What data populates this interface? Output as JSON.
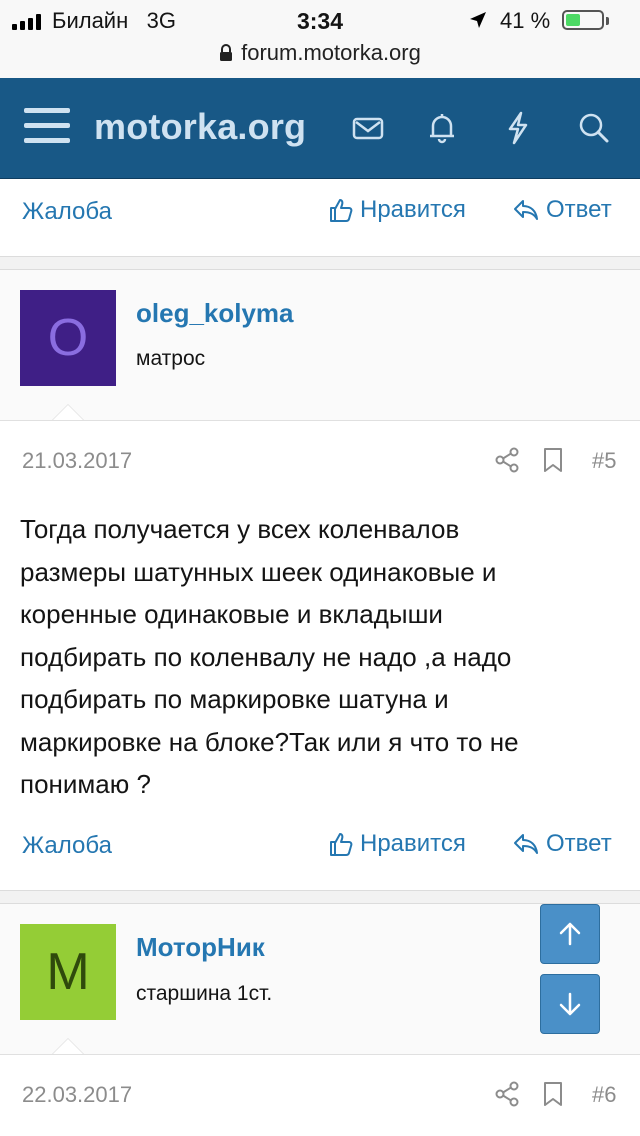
{
  "status_bar": {
    "carrier": "Билайн",
    "network": "3G",
    "time": "3:34",
    "battery_percent": "41 %",
    "battery_level": 0.41,
    "url": "forum.motorka.org"
  },
  "header": {
    "logo": "motorka.org",
    "icons": [
      "menu-icon",
      "envelope-icon",
      "bell-icon",
      "lightning-icon",
      "search-icon"
    ]
  },
  "actions": {
    "report": "Жалоба",
    "like": "Нравится",
    "reply": "Ответ"
  },
  "posts": [
    {
      "avatar_letter": "O",
      "avatar_bg": "#3f1f86",
      "avatar_fg": "#8a6de0",
      "username": "oleg_kolyma",
      "user_title": "матрос",
      "date": "21.03.2017",
      "number": "#5",
      "text_lines": [
        "Тогда получается у всех коленвалов",
        "размеры шатунных шеек одинаковые и",
        "коренные одинаковые и вкладыши",
        "подбирать по коленвалу не надо ,а надо",
        "подбирать по маркировке шатуна и",
        "маркировке на блоке?Так или я что то не",
        "понимаю ?"
      ]
    },
    {
      "avatar_letter": "M",
      "avatar_bg": "#94cd36",
      "avatar_fg": "#2f4a0c",
      "username": "МоторНик",
      "user_title": "старшина 1ст.",
      "date": "22.03.2017",
      "number": "#6"
    }
  ],
  "colors": {
    "header_bg": "#185886",
    "link": "#2577b1",
    "scroll_button": "#4a90c8"
  }
}
